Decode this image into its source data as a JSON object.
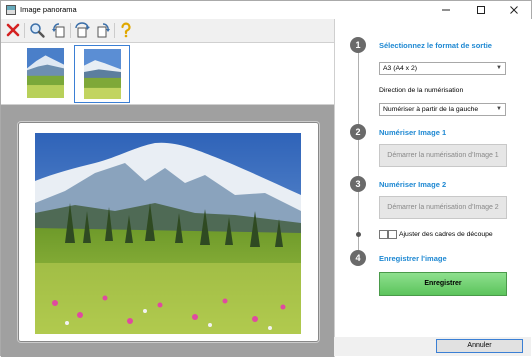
{
  "window": {
    "title": "Image panorama"
  },
  "toolbar": {
    "buttons": [
      {
        "name": "delete",
        "icon": "red-x-icon"
      },
      {
        "name": "zoom",
        "icon": "magnifier-icon"
      },
      {
        "name": "rotate-left",
        "icon": "rotate-left-icon"
      },
      {
        "name": "rotate-180",
        "icon": "rotate-180-icon"
      },
      {
        "name": "rotate-right",
        "icon": "rotate-right-icon"
      },
      {
        "name": "help",
        "icon": "help-icon"
      }
    ]
  },
  "steps": [
    {
      "number": "1",
      "title": "Sélectionnez le format de sortie"
    },
    {
      "number": "2",
      "title": "Numériser Image 1"
    },
    {
      "number": "3",
      "title": "Numériser Image 2"
    },
    {
      "number": "4",
      "title": "Enregistrer l'image"
    }
  ],
  "format_select": {
    "value": "A3 (A4 x 2)"
  },
  "direction_label": "Direction de la numérisation",
  "direction_select": {
    "value": "Numériser à partir de la gauche"
  },
  "scan1_button": "Démarrer la numérisation d'Image 1",
  "scan2_button": "Démarrer la numérisation d'Image 2",
  "adjust_frames_label": "Ajuster des cadres de découpe",
  "save_button": "Enregistrer",
  "cancel_button": "Annuler",
  "colors": {
    "accent": "#1e88d2",
    "save_green": "#5cc45c",
    "selection": "#3b7fd4"
  }
}
